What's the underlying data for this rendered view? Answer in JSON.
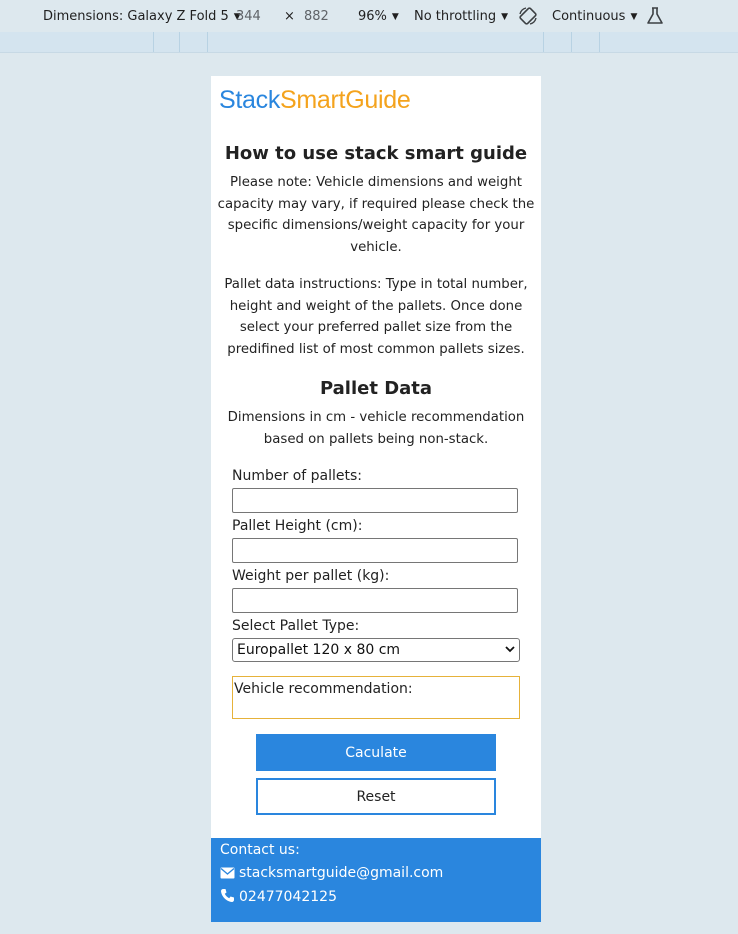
{
  "devtools": {
    "device_label": "Dimensions: Galaxy Z Fold 5",
    "width_value": "344",
    "times": "×",
    "height_value": "882",
    "zoom": "96%",
    "throttling": "No throttling",
    "mode": "Continuous"
  },
  "logo": {
    "part1": "Stack",
    "part2": "SmartGuide"
  },
  "guide": {
    "title": "How to use stack smart guide",
    "note": "Please note: Vehicle dimensions and weight capacity may vary, if required please check the specific dimensions/weight capacity for your vehicle.",
    "instructions": "Pallet data instructions: Type in total number, height and weight of the pallets. Once done select your preferred pallet size from the predifined list of most common pallets sizes."
  },
  "pallet": {
    "title": "Pallet Data",
    "subtitle": "Dimensions in cm - vehicle recommendation based on pallets being non-stack.",
    "number_label": "Number of pallets:",
    "number_value": "",
    "height_label": "Pallet Height (cm):",
    "height_value": "",
    "weight_label": "Weight per pallet (kg):",
    "weight_value": "",
    "type_label": "Select Pallet Type:",
    "type_selected": "Europallet 120 x 80 cm",
    "recommendation_label": "Vehicle recommendation:"
  },
  "buttons": {
    "calculate": "Caculate",
    "reset": "Reset"
  },
  "footer": {
    "heading": "Contact us:",
    "email": "stacksmartguide@gmail.com",
    "phone": "02477042125"
  },
  "colors": {
    "brand_blue": "#2a86de",
    "brand_orange": "#f4a31d",
    "rec_border": "#e6b23a",
    "page_bg": "#dde8ee"
  }
}
